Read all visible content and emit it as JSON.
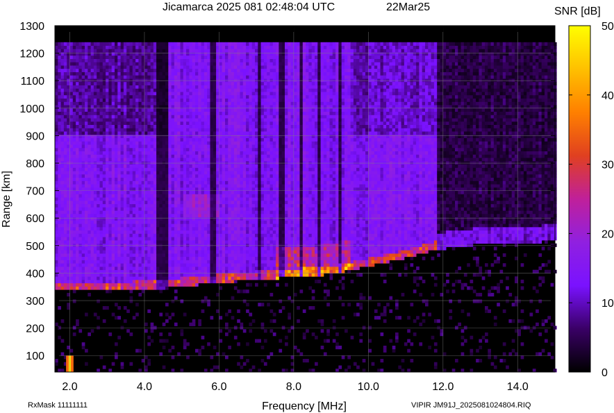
{
  "chart_data": {
    "type": "heatmap",
    "title": "Jicamarca 2025 081 02:48:04 UTC",
    "date": "22Mar25",
    "xlabel": "Frequency [MHz]",
    "ylabel": "Range [km]",
    "xlim": [
      1.6,
      15.0
    ],
    "ylim": [
      40,
      1300
    ],
    "xticks": [
      2.0,
      4.0,
      6.0,
      8.0,
      10.0,
      12.0,
      14.0
    ],
    "xtick_labels": [
      "2.0",
      "4.0",
      "6.0",
      "8.0",
      "10.0",
      "12.0",
      "14.0"
    ],
    "yticks": [
      100,
      200,
      300,
      400,
      500,
      600,
      700,
      800,
      900,
      1000,
      1100,
      1200,
      1300
    ],
    "ytick_labels": [
      "100",
      "200",
      "300",
      "400",
      "500",
      "600",
      "700",
      "800",
      "900",
      "1000",
      "1100",
      "1200",
      "1300"
    ],
    "grid": true,
    "colorbar": {
      "label": "SNR [dB]",
      "range": [
        0,
        50
      ],
      "ticks": [
        0,
        10,
        20,
        30,
        40,
        50
      ],
      "tick_labels": [
        "0",
        "10",
        "20",
        "30",
        "40",
        "50"
      ],
      "colors": [
        "#000000",
        "#3a0066",
        "#7a12ff",
        "#9020e0",
        "#c0209a",
        "#e04020",
        "#ff8000",
        "#ffc000",
        "#ffff00"
      ]
    },
    "data_extent": {
      "freq_max": 15.0,
      "range_max": 1240
    },
    "trace": {
      "description": "virtual height of O-mode echo trace",
      "points": [
        [
          1.6,
          330
        ],
        [
          3.0,
          330
        ],
        [
          4.5,
          340
        ],
        [
          6.0,
          360
        ],
        [
          7.5,
          375
        ],
        [
          9.0,
          390
        ],
        [
          10.0,
          420
        ],
        [
          11.0,
          450
        ],
        [
          11.8,
          480
        ],
        [
          13.0,
          500
        ],
        [
          15.0,
          510
        ]
      ]
    },
    "interference_band": {
      "freq": 2.0,
      "range": [
        40,
        100
      ]
    }
  },
  "footer": {
    "left": "RxMask 11111111",
    "right": "VIPIR  JM91J_2025081024804.RIQ"
  }
}
